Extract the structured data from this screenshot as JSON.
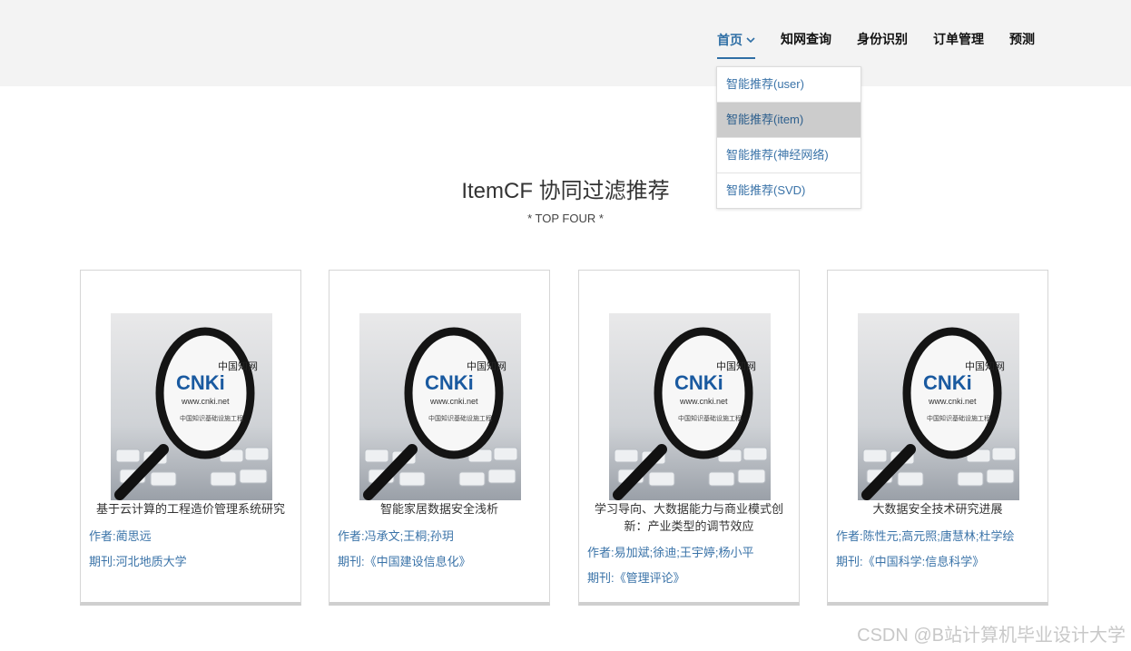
{
  "nav": {
    "items": [
      {
        "label": "首页",
        "active": true
      },
      {
        "label": "知网查询"
      },
      {
        "label": "身份识别"
      },
      {
        "label": "订单管理"
      },
      {
        "label": "预测"
      }
    ],
    "accent_color": "#2f6fa5"
  },
  "dropdown": {
    "items": [
      {
        "label": "智能推荐(user)"
      },
      {
        "label": "智能推荐(item)",
        "highlighted": true
      },
      {
        "label": "智能推荐(神经网络)"
      },
      {
        "label": "智能推荐(SVD)"
      }
    ]
  },
  "main": {
    "title": "ItemCF 协同过滤推荐",
    "subtitle": "* TOP FOUR *"
  },
  "cards": [
    {
      "title": "基于云计算的工程造价管理系统研究",
      "author": "作者:蔺思远",
      "journal": "期刊:河北地质大学",
      "thumb_icon": "cnki-magnifier-image"
    },
    {
      "title": "智能家居数据安全浅析",
      "author": "作者:冯承文;王桐;孙玥",
      "journal": "期刊:《中国建设信息化》",
      "thumb_icon": "cnki-magnifier-image"
    },
    {
      "title": "学习导向、大数据能力与商业模式创新：产业类型的调节效应",
      "author": "作者:易加斌;徐迪;王宇婷;杨小平",
      "journal": "期刊:《管理评论》",
      "thumb_icon": "cnki-magnifier-image"
    },
    {
      "title": "大数据安全技术研究进展",
      "author": "作者:陈性元;高元照;唐慧林;杜学绘",
      "journal": "期刊:《中国科学:信息科学》",
      "thumb_icon": "cnki-magnifier-image"
    }
  ],
  "watermark": "CSDN @B站计算机毕业设计大学"
}
